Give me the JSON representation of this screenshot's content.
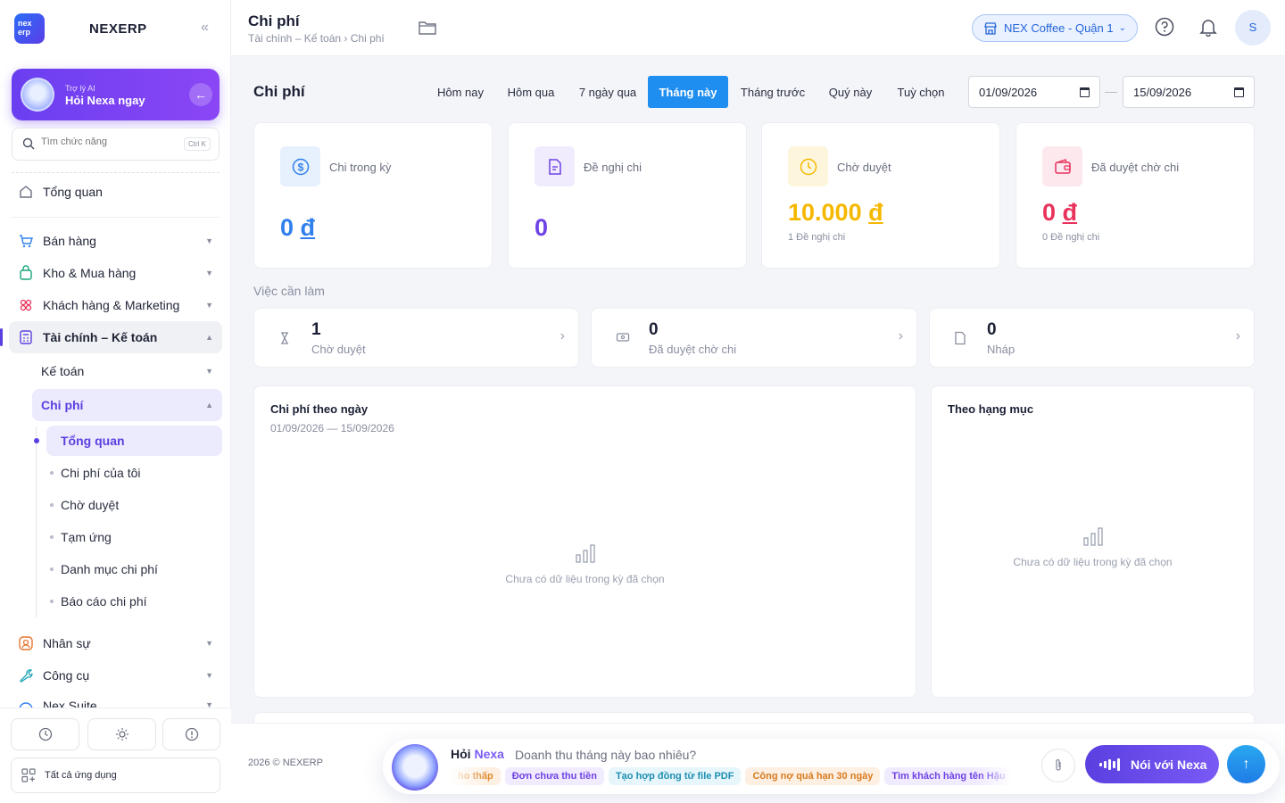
{
  "sidebar": {
    "brand": "NEXERP",
    "logo_text": "nex erp",
    "ai_small": "Trợ lý AI",
    "ai_big": "Hỏi Nexa ngay",
    "search_placeholder": "Tìm chức năng",
    "search_shortcut": "Ctrl K",
    "overview": "Tổng quan",
    "items": [
      {
        "label": "Bán hàng",
        "icon": "cart-icon"
      },
      {
        "label": "Kho & Mua hàng",
        "icon": "bag-icon"
      },
      {
        "label": "Khách hàng & Marketing",
        "icon": "users-icon"
      },
      {
        "label": "Tài chính – Kế toán",
        "icon": "calculator-icon"
      }
    ],
    "sub_accounting": "Kế toán",
    "sub_expense": "Chi phí",
    "leaves": [
      "Tổng quan",
      "Chi phí của tôi",
      "Chờ duyệt",
      "Tạm ứng",
      "Danh mục chi phí",
      "Báo cáo chi phí"
    ],
    "items_after": [
      {
        "label": "Nhân sự",
        "icon": "person-icon"
      },
      {
        "label": "Công cụ",
        "icon": "wrench-icon"
      },
      {
        "label": "Nex Suite",
        "icon": "suite-icon"
      }
    ],
    "all_apps": "Tất cả ứng dụng"
  },
  "topbar": {
    "title": "Chi phí",
    "breadcrumb": "Tài chính – Kế toán › Chi phí",
    "store": "NEX Coffee - Quận 1",
    "avatar": "S"
  },
  "page": {
    "title": "Chi phí",
    "periods": [
      "Hôm nay",
      "Hôm qua",
      "7 ngày qua",
      "Tháng này",
      "Tháng trước",
      "Quý này",
      "Tuỳ chọn"
    ],
    "active_period": "Tháng này",
    "date_from": "01/09/2026",
    "date_to": "15/09/2026"
  },
  "stats": [
    {
      "label": "Chi trong kỳ",
      "value": "0",
      "currency": "đ",
      "sub": "",
      "color": "#2f80ed"
    },
    {
      "label": "Đề nghị chi",
      "value": "0",
      "currency": "",
      "sub": "",
      "color": "#6e42e5"
    },
    {
      "label": "Chờ duyệt",
      "value": "10.000",
      "currency": "đ",
      "sub": "1 Đề nghị chi",
      "color": "#f5b800"
    },
    {
      "label": "Đã duyệt chờ chi",
      "value": "0",
      "currency": "đ",
      "sub": "0 Đề nghị chi",
      "color": "#e8315b"
    }
  ],
  "todo": {
    "title": "Việc cần làm",
    "items": [
      {
        "count": "1",
        "label": "Chờ duyệt",
        "icon": "hourglass-icon"
      },
      {
        "count": "0",
        "label": "Đã duyệt chờ chi",
        "icon": "cash-icon"
      },
      {
        "count": "0",
        "label": "Nháp",
        "icon": "file-icon"
      }
    ]
  },
  "charts": {
    "daily_title": "Chi phí theo ngày",
    "daily_range": "01/09/2026 — 15/09/2026",
    "category_title": "Theo hạng mục",
    "empty": "Chưa có dữ liệu trong kỳ đã chọn"
  },
  "footer": {
    "copyright": "2026 © NEXERP",
    "ask_prefix": "Hỏi",
    "ask_name": "Nexa",
    "ask_question": "Doanh thu tháng này bao nhiêu?",
    "chips": [
      {
        "label": "ho thấp",
        "bg": "#fdf0e3",
        "fg": "#e08a2e"
      },
      {
        "label": "Đơn chưa thu tiền",
        "bg": "#f1ebff",
        "fg": "#6e42e5"
      },
      {
        "label": "Tạo hợp đồng từ file PDF",
        "bg": "#e6f6fb",
        "fg": "#1f8fb3"
      },
      {
        "label": "Công nợ quá hạn 30 ngày",
        "bg": "#fdf0e3",
        "fg": "#d87a1e"
      },
      {
        "label": "Tìm khách hàng tên Hậu",
        "bg": "#f1ebff",
        "fg": "#6e42e5"
      }
    ],
    "voice": "Nói với Nexa"
  }
}
